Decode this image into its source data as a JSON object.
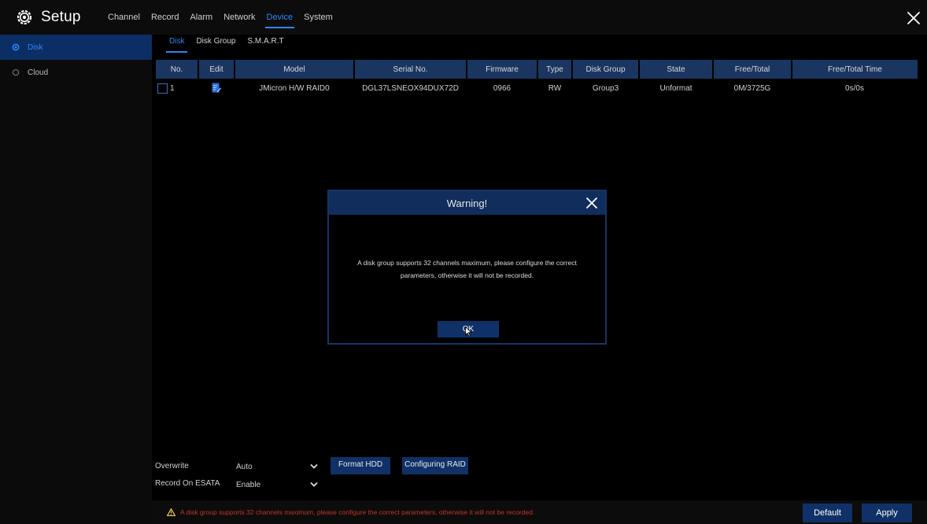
{
  "header": {
    "title": "Setup",
    "tabs": [
      {
        "label": "Channel",
        "active": false
      },
      {
        "label": "Record",
        "active": false
      },
      {
        "label": "Alarm",
        "active": false
      },
      {
        "label": "Network",
        "active": false
      },
      {
        "label": "Device",
        "active": true
      },
      {
        "label": "System",
        "active": false
      }
    ],
    "accent": "#2f86f5"
  },
  "sidebar": {
    "items": [
      {
        "label": "Disk",
        "active": true
      },
      {
        "label": "Cloud",
        "active": false
      }
    ]
  },
  "subtabs": [
    {
      "label": "Disk",
      "active": true
    },
    {
      "label": "Disk Group",
      "active": false
    },
    {
      "label": "S.M.A.R.T",
      "active": false
    }
  ],
  "table": {
    "columns": [
      "No.",
      "Edit",
      "Model",
      "Serial No.",
      "Firmware",
      "Type",
      "Disk Group",
      "State",
      "Free/Total",
      "Free/Total Time"
    ],
    "rows": [
      {
        "no": "1",
        "model": "JMicron H/W RAID0",
        "serial": "DGL37LSNEOX94DUX72D",
        "firmware": "0966",
        "type": "RW",
        "disk_group": "Group3",
        "state": "Unformat",
        "free_total": "0M/3725G",
        "free_total_time": "0s/0s"
      }
    ]
  },
  "options": {
    "overwrite_label": "Overwrite",
    "overwrite_value": "Auto",
    "esata_label": "Record On ESATA",
    "esata_value": "Enable",
    "format_hdd_label": "Format HDD",
    "configuring_raid_label": "Configuring RAID"
  },
  "status": {
    "warning_text": "A disk group supports 32 channels maximum, please configure the correct parameters, otherwise it will not be recorded.",
    "warning_color": "#c4332b",
    "default_label": "Default",
    "apply_label": "Apply"
  },
  "dialog": {
    "title": "Warning!",
    "message_line1": "A disk group supports 32 channels maximum, please configure the correct",
    "message_line2": "parameters, otherwise it will not be recorded.",
    "ok_label": "OK"
  },
  "icons": {
    "brand": "gear-icon",
    "close": "close-icon",
    "edit": "edit-icon",
    "warning": "warning-icon",
    "dropdown": "chevron-down-icon"
  }
}
